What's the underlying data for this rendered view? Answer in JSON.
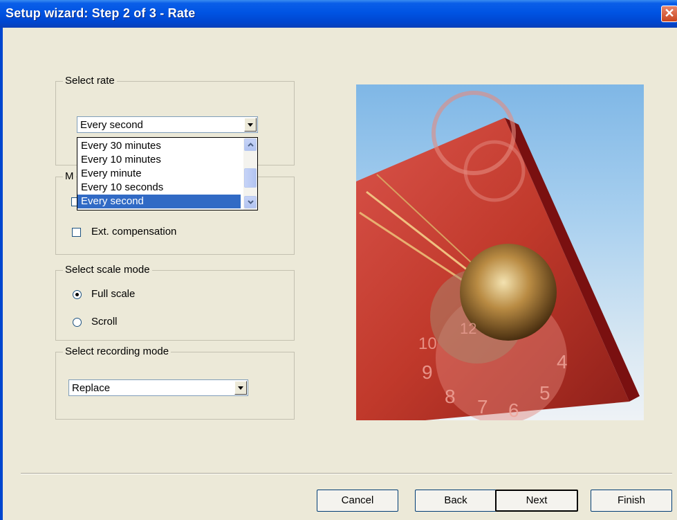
{
  "window": {
    "title": "Setup wizard: Step 2 of 3 - Rate",
    "close_glyph": "✕"
  },
  "select_rate": {
    "legend": "Select rate",
    "value": "Every second",
    "options": [
      "Every 30 minutes",
      "Every 10 minutes",
      "Every minute",
      "Every 10 seconds",
      "Every second"
    ],
    "selected_index": 4
  },
  "measurement": {
    "legend_fragment": "M",
    "ext_compensation_label": "Ext. compensation",
    "ext_compensation_checked": false
  },
  "scale_mode": {
    "legend": "Select scale mode",
    "options": [
      "Full scale",
      "Scroll"
    ],
    "selected": "Full scale"
  },
  "recording_mode": {
    "legend": "Select recording mode",
    "value": "Replace"
  },
  "buttons": {
    "cancel": "Cancel",
    "back": "Back",
    "next": "Next",
    "finish": "Finish"
  },
  "picture": {
    "numbers": [
      "9",
      "8",
      "7",
      "6",
      "5",
      "4",
      "10",
      "12"
    ]
  },
  "colors": {
    "titlebar": "#0054e3",
    "selection": "#316ac5",
    "dialog_bg": "#ece9d8"
  }
}
